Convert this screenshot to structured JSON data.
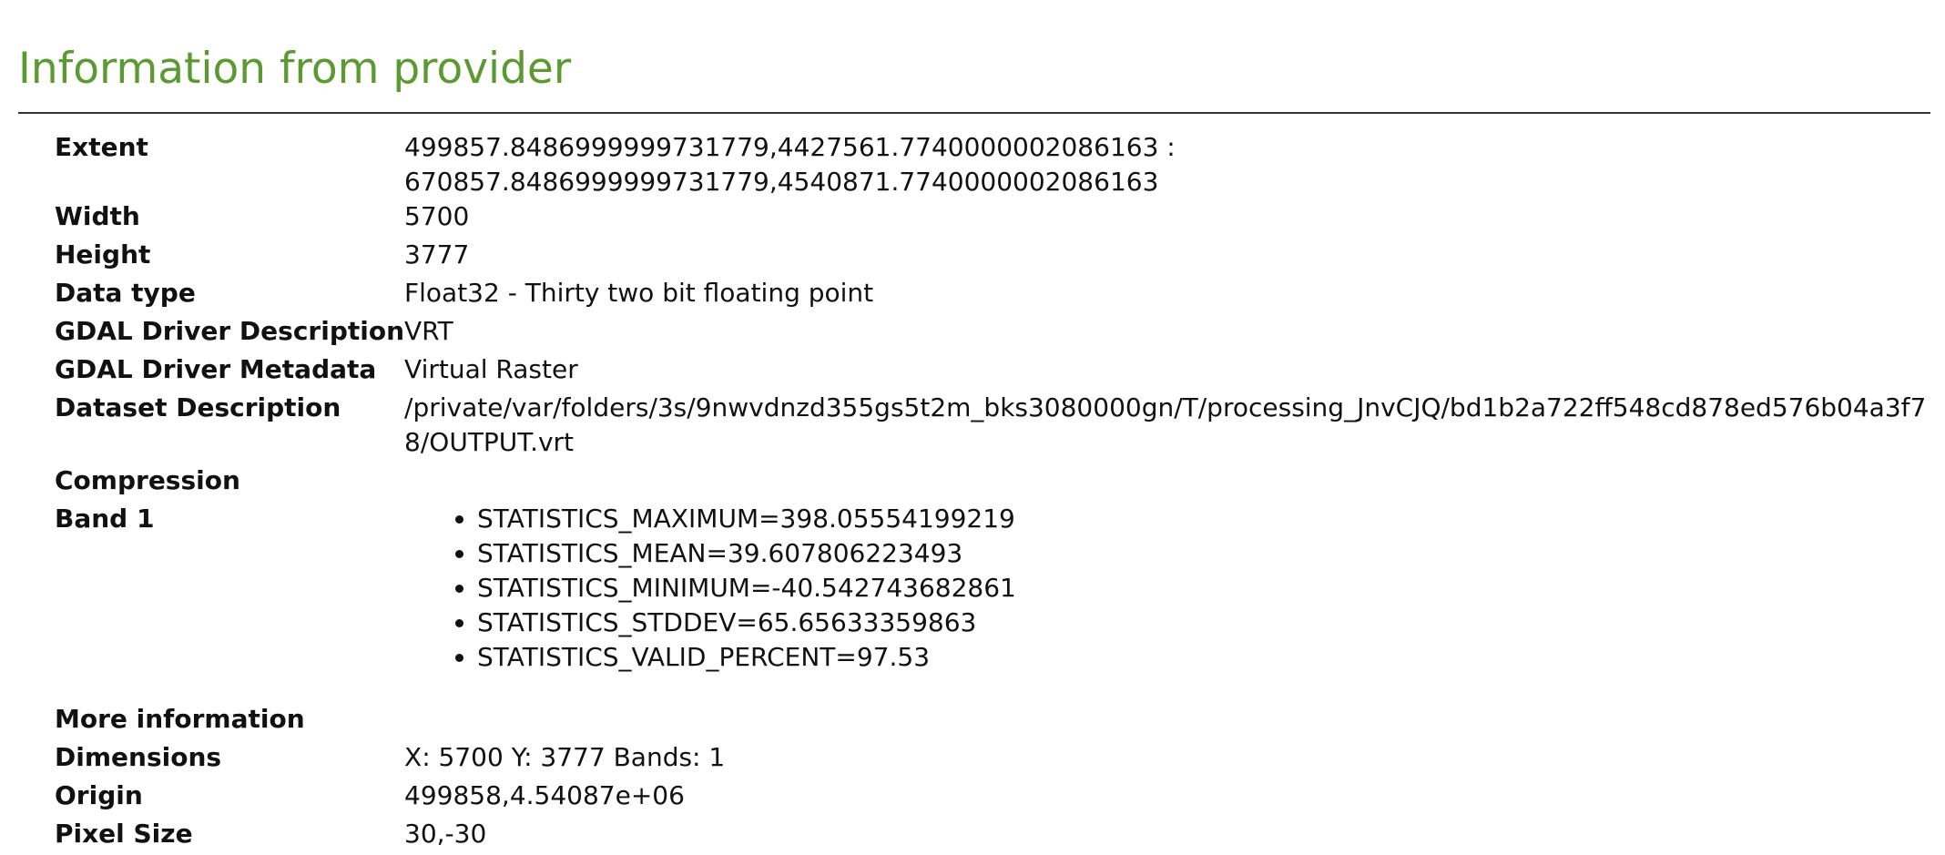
{
  "section": {
    "title": "Information from provider"
  },
  "provider_info": {
    "extent": {
      "label": "Extent",
      "value": "499857.8486999999731779,4427561.7740000002086163 : 670857.8486999999731779,4540871.7740000002086163"
    },
    "width": {
      "label": "Width",
      "value": "5700"
    },
    "height": {
      "label": "Height",
      "value": "3777"
    },
    "data_type": {
      "label": "Data type",
      "value": "Float32 - Thirty two bit floating point"
    },
    "gdal_driver_description": {
      "label": "GDAL Driver Description",
      "value": "VRT"
    },
    "gdal_driver_metadata": {
      "label": "GDAL Driver Metadata",
      "value": "Virtual Raster"
    },
    "dataset_description": {
      "label": "Dataset Description",
      "value": "/private/var/folders/3s/9nwvdnzd355gs5t2m_bks3080000gn/T/processing_JnvCJQ/bd1b2a722ff548cd878ed576b04a3f78/OUTPUT.vrt"
    },
    "compression": {
      "label": "Compression",
      "value": ""
    },
    "band_1": {
      "label": "Band 1",
      "items": [
        "STATISTICS_MAXIMUM=398.05554199219",
        "STATISTICS_MEAN=39.607806223493",
        "STATISTICS_MINIMUM=-40.542743682861",
        "STATISTICS_STDDEV=65.65633359863",
        "STATISTICS_VALID_PERCENT=97.53"
      ]
    }
  },
  "more_information": {
    "heading": "More information",
    "dimensions": {
      "label": "Dimensions",
      "value": "X: 5700 Y: 3777 Bands: 1"
    },
    "origin": {
      "label": "Origin",
      "value": "499858,4.54087e+06"
    },
    "pixel_size": {
      "label": "Pixel Size",
      "value": "30,-30"
    }
  }
}
